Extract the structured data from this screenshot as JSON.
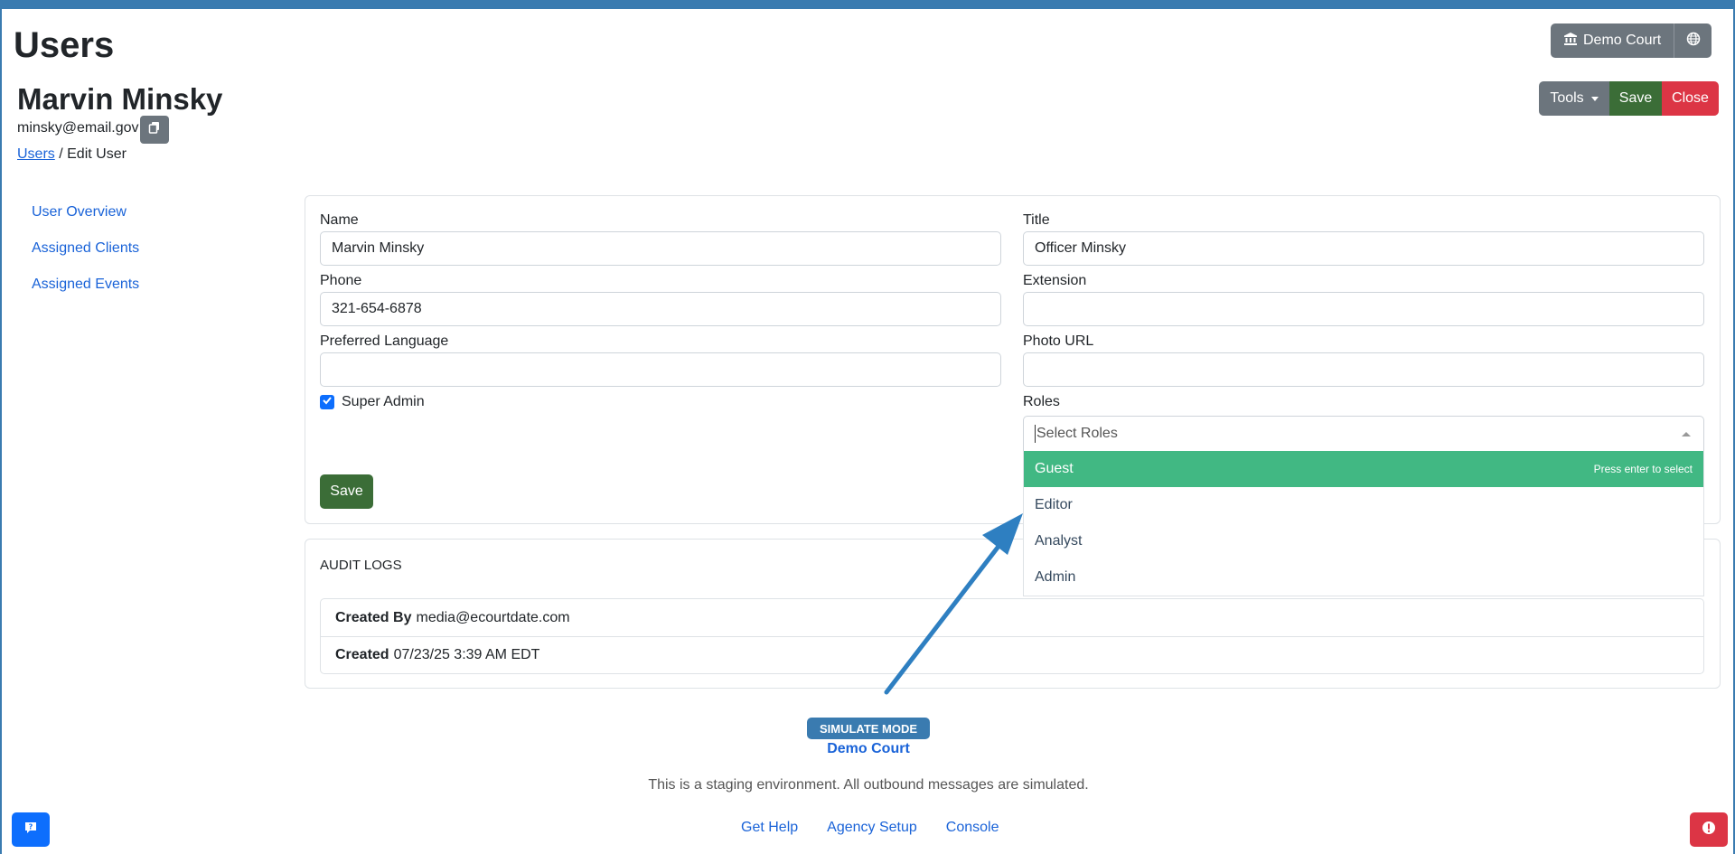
{
  "page": {
    "title": "Users"
  },
  "user": {
    "name": "Marvin Minsky",
    "email": "minsky@email.gov"
  },
  "breadcrumb": {
    "link": "Users",
    "separator": " / ",
    "current": "Edit User"
  },
  "header": {
    "court_label": "Demo Court",
    "tools_label": "Tools",
    "save_label": "Save",
    "close_label": "Close"
  },
  "sidebar": {
    "items": [
      {
        "label": "User Overview"
      },
      {
        "label": "Assigned Clients"
      },
      {
        "label": "Assigned Events"
      }
    ]
  },
  "form": {
    "name": {
      "label": "Name",
      "value": "Marvin Minsky"
    },
    "title": {
      "label": "Title",
      "value": "Officer Minsky"
    },
    "phone": {
      "label": "Phone",
      "value": "321-654-6878"
    },
    "extension": {
      "label": "Extension",
      "value": ""
    },
    "language": {
      "label": "Preferred Language",
      "value": ""
    },
    "photo": {
      "label": "Photo URL",
      "value": ""
    },
    "super_admin": {
      "label": "Super Admin",
      "checked": true
    },
    "roles": {
      "label": "Roles",
      "placeholder": "Select Roles",
      "options": [
        {
          "label": "Guest",
          "highlighted": true
        },
        {
          "label": "Editor"
        },
        {
          "label": "Analyst"
        },
        {
          "label": "Admin"
        }
      ],
      "hint": "Press enter to select"
    },
    "save_label": "Save"
  },
  "audit": {
    "title": "AUDIT LOGS",
    "rows": [
      {
        "key": "Created By",
        "value": "media@ecourtdate.com"
      },
      {
        "key": "Created",
        "value": "07/23/25 3:39 AM EDT"
      }
    ]
  },
  "footer": {
    "badge": "SIMULATE MODE",
    "court": "Demo Court",
    "notice": "This is a staging environment. All outbound messages are simulated.",
    "links": [
      {
        "label": "Get Help"
      },
      {
        "label": "Agency Setup"
      },
      {
        "label": "Console"
      }
    ]
  },
  "colors": {
    "brand": "#3a7bb0",
    "success": "#3b6d37",
    "danger": "#dc3545",
    "highlight": "#41b883",
    "link": "#1a63d8"
  },
  "icons": [
    "bank-icon",
    "globe-icon",
    "copy-icon",
    "checkmark-icon",
    "chat-icon",
    "alert-icon",
    "arrow-annotation"
  ]
}
